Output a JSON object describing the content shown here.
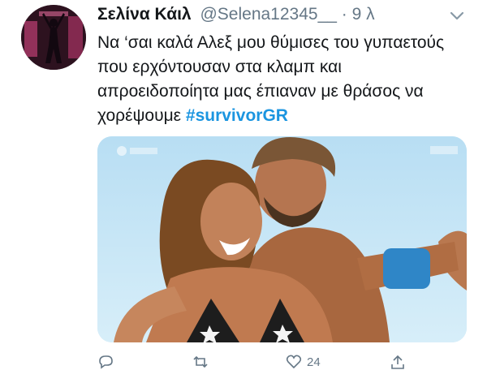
{
  "user": {
    "display_name": "Σελίνα Κάιλ",
    "handle": "@Selena12345__",
    "separator": "·",
    "time": "9 λ"
  },
  "tweet": {
    "text": "Να ‘σαι καλά Αλεξ μου θύμισες του γυπαετούς που ερχόντουσαν στα κλαμπ και απροειδοποίητα μας έπιαναν με θράσος να χορέψουμε",
    "hashtag": "#survivorGR"
  },
  "media": {
    "type": "photo",
    "description_icon": "tweet-photo"
  },
  "actions": {
    "reply_icon": "reply-icon",
    "retweet_icon": "retweet-icon",
    "like_icon": "heart-icon",
    "like_count": "24",
    "share_icon": "share-icon"
  },
  "colors": {
    "link": "#1b95e0",
    "secondary": "#657786",
    "text": "#14171a"
  }
}
